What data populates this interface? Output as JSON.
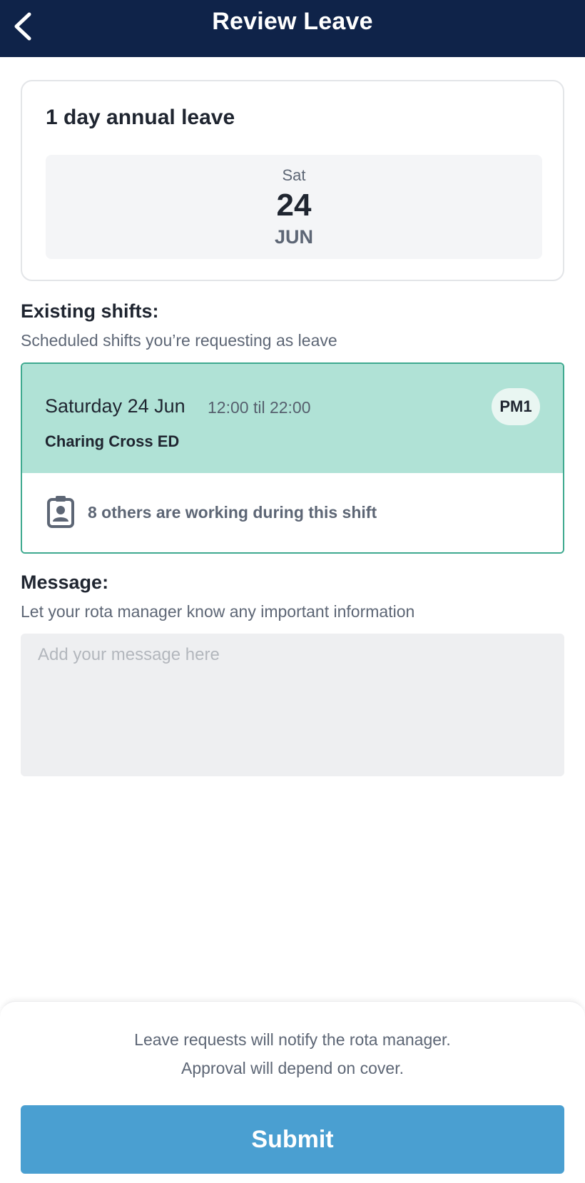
{
  "header": {
    "title": "Review Leave",
    "back_icon": "chevron-left-icon"
  },
  "leave": {
    "title": "1 day annual leave",
    "date": {
      "day": "Sat",
      "number": "24",
      "month": "JUN"
    }
  },
  "existing_shifts": {
    "heading": "Existing shifts:",
    "subheading": "Scheduled shifts you’re requesting as leave",
    "shift": {
      "date": "Saturday 24 Jun",
      "time": "12:00 til 22:00",
      "location": "Charing Cross ED",
      "badge": "PM1",
      "colleagues_text": "8 others are working during this shift",
      "colleagues_icon": "id-badge-icon"
    }
  },
  "message": {
    "heading": "Message:",
    "subheading": "Let your rota manager know any important information",
    "value": "",
    "placeholder": "Add your message here"
  },
  "footer": {
    "note_line1": "Leave requests will notify the rota manager.",
    "note_line2": "Approval will depend on cover.",
    "submit_label": "Submit"
  },
  "colors": {
    "header_bg": "#0f2349",
    "shift_bg": "#b0e2d6",
    "shift_border": "#3ea98f",
    "submit_bg": "#4a9fd1"
  }
}
